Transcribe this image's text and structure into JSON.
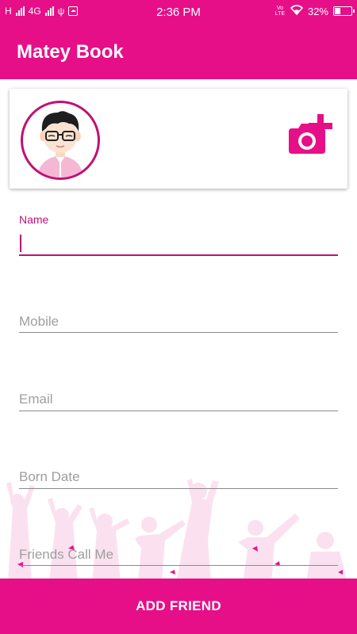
{
  "status_bar": {
    "network_left": "H",
    "network_mid": "4G",
    "time": "2:36 PM",
    "lte_badge": "Vo LTE",
    "battery": "32%",
    "battery_level": 0.32
  },
  "app_bar": {
    "title": "Matey Book"
  },
  "profile_card": {
    "avatar_icon": "cartoon-boy-avatar",
    "camera_icon": "add-a-photo-icon"
  },
  "form": {
    "fields": [
      {
        "label": "Name",
        "value": ""
      },
      {
        "label": "Mobile",
        "value": ""
      },
      {
        "label": "Email",
        "value": ""
      },
      {
        "label": "Born Date",
        "value": ""
      },
      {
        "label": "Friends Call Me",
        "value": ""
      }
    ]
  },
  "actions": {
    "add_friend": "ADD FRIEND"
  },
  "colors": {
    "primary": "#e60f88",
    "accent": "#c21075",
    "decor": "#f9d8ea"
  }
}
